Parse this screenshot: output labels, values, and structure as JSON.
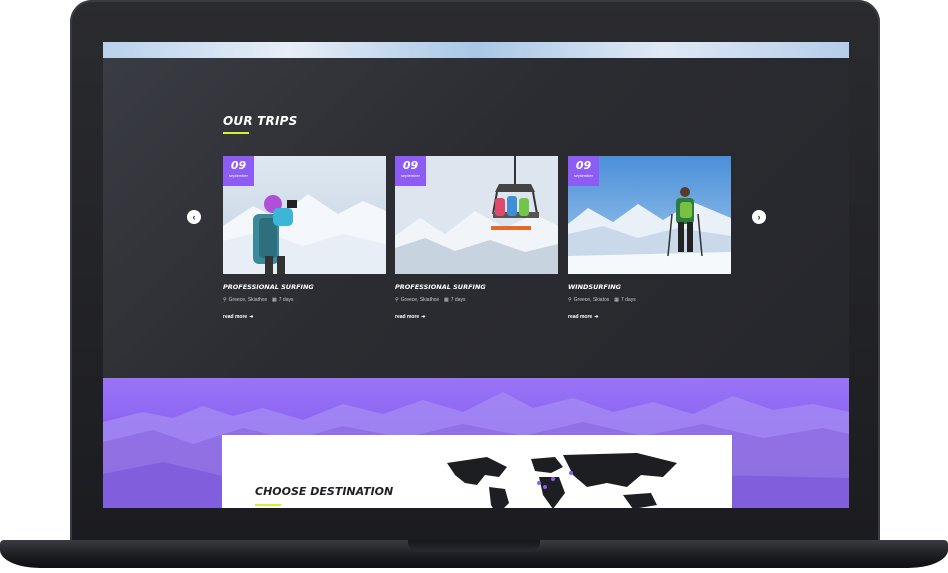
{
  "section": {
    "title": "OUR TRIPS"
  },
  "trips": [
    {
      "day": "09",
      "month": "september",
      "title": "PROFESSIONAL SURFING",
      "location": "Greece, Skiathos",
      "duration": "7 days",
      "link": "read more"
    },
    {
      "day": "09",
      "month": "september",
      "title": "PROFESSIONAL SURFING",
      "location": "Greece, Skiathos",
      "duration": "7 days",
      "link": "read more"
    },
    {
      "day": "09",
      "month": "september",
      "title": "WINDSURFING",
      "location": "Greece, Skiatos",
      "duration": "7 days",
      "link": "read more"
    }
  ],
  "carousel": {
    "prev_icon": "chevron-left-icon",
    "next_icon": "chevron-right-icon",
    "prev_glyph": "‹",
    "next_glyph": "›"
  },
  "destination": {
    "title": "CHOOSE DESTINATION"
  },
  "icons": {
    "location": "map-pin-icon",
    "calendar": "calendar-icon",
    "arrow": "arrow-right-icon"
  },
  "colors": {
    "accent_purple": "#8c5cf5",
    "underline_lime": "#d4f03a",
    "dark_background": "#2b2c31",
    "destination_gradient_top": "#9a74f7"
  }
}
